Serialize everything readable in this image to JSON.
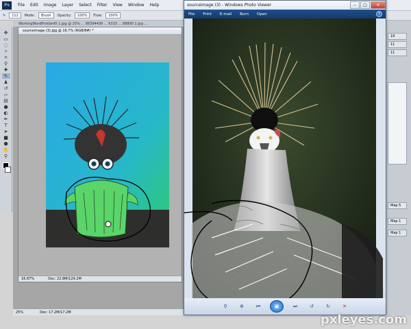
{
  "photoshop": {
    "logo": "Ps",
    "menus": [
      "File",
      "Edit",
      "Image",
      "Layer",
      "Select",
      "Filter",
      "View",
      "Window",
      "Help"
    ],
    "options": {
      "mode_label": "Mode:",
      "mode_value": "Brush",
      "opacity_label": "Opacity:",
      "opacity_value": "100%",
      "flow_label": "Flow:",
      "flow_value": "100%",
      "brush_size": "112"
    },
    "document_tabs": "WorkingWordPinkbird0 1.jpg @ 25% ... 88394436 ... 6333 ... 88890 1.jpg ...",
    "document": {
      "title": "sourceimage (3).jpg @ 16.7% (RGB/8#) *",
      "zoom": "16.67%",
      "doc_size": "Doc: 22.8M/129.2M"
    },
    "bottom_status": {
      "zoom": "25%",
      "doc_size": "Doc: 17.2M/17.2M"
    },
    "panel_numbers": [
      "19",
      "11",
      "11"
    ],
    "panel_labels": [
      "Map 5",
      "Map 1",
      "Map 1"
    ]
  },
  "photo_viewer": {
    "title": "sourceimage (3) - Windows Photo Viewer",
    "menus": [
      "File",
      "Print",
      "E-mail",
      "Burn",
      "Open"
    ],
    "caption_min": "–",
    "caption_max": "□",
    "caption_close": "✕",
    "help": "?"
  },
  "watermark": "pxleyes.com",
  "colors": {
    "ps_menubar": "#e9edf3",
    "pv_menubar": "#1f4e8c",
    "canvas_gradient_top": "#2aa9e6",
    "canvas_gradient_bottom": "#2ecc6a"
  }
}
